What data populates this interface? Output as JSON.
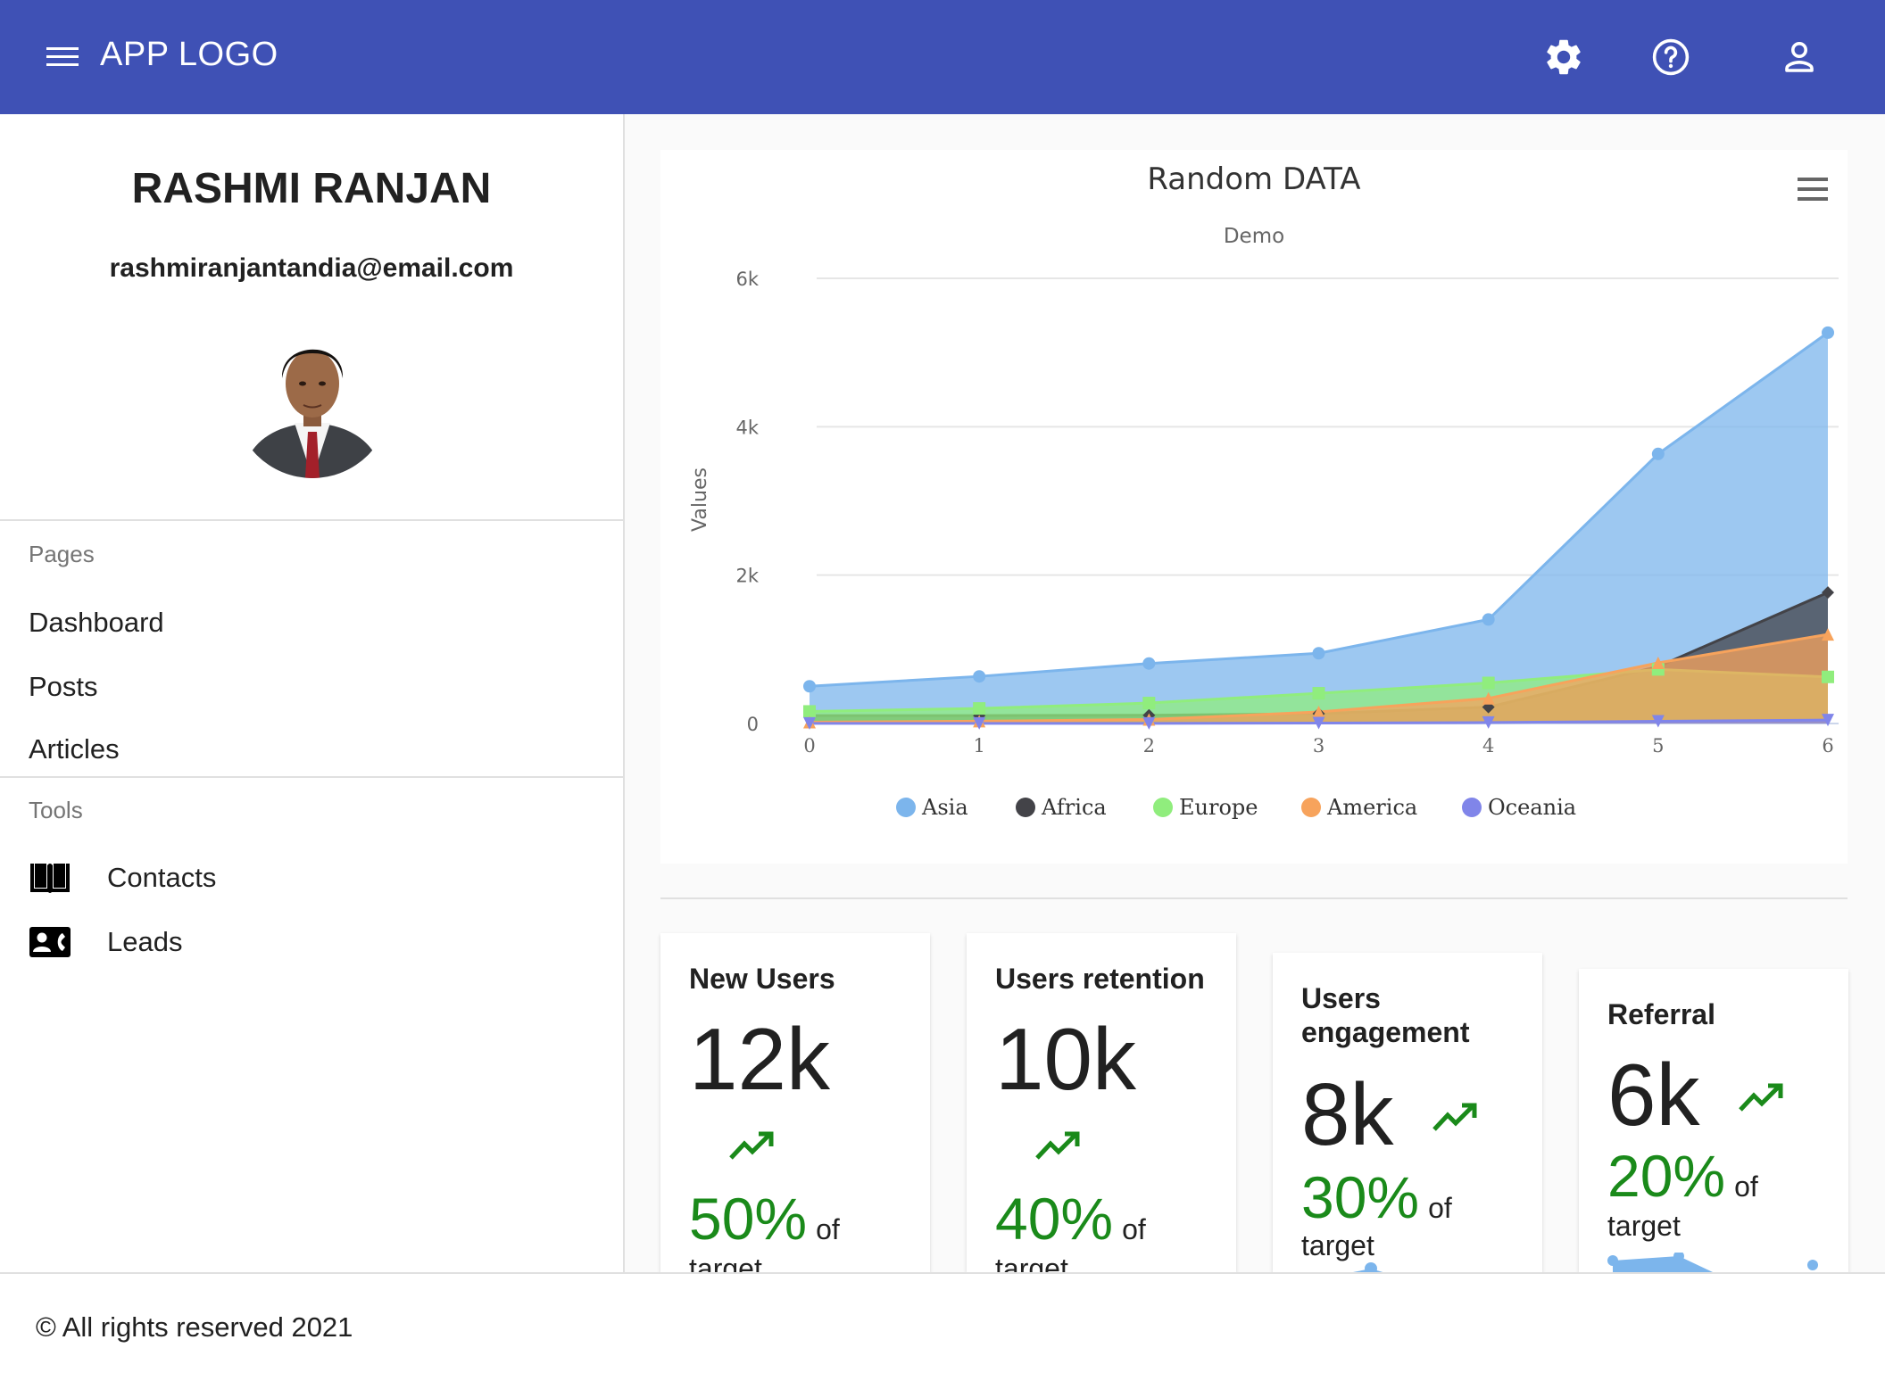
{
  "topbar": {
    "title": "APP LOGO",
    "icons": [
      "menu-icon",
      "settings-icon",
      "help-icon",
      "account-icon"
    ]
  },
  "profile": {
    "name": "RASHMI RANJAN",
    "email": "rashmiranjantandia@email.com"
  },
  "sidebar": {
    "pages_header": "Pages",
    "pages": [
      {
        "label": "Dashboard"
      },
      {
        "label": "Posts"
      },
      {
        "label": "Articles"
      }
    ],
    "tools_header": "Tools",
    "tools": [
      {
        "label": "Contacts",
        "icon": "book-icon"
      },
      {
        "label": "Leads",
        "icon": "contact-card-icon"
      }
    ]
  },
  "chart_data": {
    "type": "area",
    "title": "Random DATA",
    "subtitle": "Demo",
    "ylabel": "Values",
    "xlabel": "",
    "x": [
      0,
      1,
      2,
      3,
      4,
      5,
      6
    ],
    "x_tick_labels": [
      "0",
      "1",
      "2",
      "3",
      "4",
      "5",
      "6"
    ],
    "ylim": [
      0,
      6000
    ],
    "y_tick_labels": [
      "0",
      "2k",
      "4k",
      "6k"
    ],
    "y_tick_values": [
      0,
      2000,
      4000,
      6000
    ],
    "grid": true,
    "legend_position": "bottom",
    "stacked": false,
    "series": [
      {
        "name": "Asia",
        "color": "#7cb5ec",
        "marker": "circle",
        "values": [
          502,
          635,
          809,
          947,
          1402,
          3634,
          5268
        ]
      },
      {
        "name": "Africa",
        "color": "#434348",
        "marker": "diamond",
        "values": [
          106,
          107,
          111,
          133,
          221,
          767,
          1766
        ]
      },
      {
        "name": "Europe",
        "color": "#90ed7d",
        "marker": "square",
        "values": [
          163,
          203,
          276,
          408,
          547,
          729,
          628
        ]
      },
      {
        "name": "America",
        "color": "#f7a35c",
        "marker": "triangle",
        "values": [
          18,
          31,
          54,
          156,
          339,
          818,
          1201
        ]
      },
      {
        "name": "Oceania",
        "color": "#8085e9",
        "marker": "triangle-down",
        "values": [
          2,
          2,
          2,
          6,
          13,
          30,
          46
        ]
      }
    ]
  },
  "stats": [
    {
      "title": "New Users",
      "value": "12k",
      "percent": "50%",
      "of": "of",
      "target": "target",
      "color": "#1a8a1a"
    },
    {
      "title": "Users retention",
      "value": "10k",
      "percent": "40%",
      "of": "of",
      "target": "target",
      "color": "#1a8a1a"
    },
    {
      "title": "Users engagement",
      "value": "8k",
      "percent": "30%",
      "of": "of",
      "target": "target",
      "color": "#1a8a1a"
    },
    {
      "title": "Referral",
      "value": "6k",
      "percent": "20%",
      "of": "of",
      "target": "target",
      "color": "#1a8a1a"
    }
  ],
  "footer": {
    "text": "© All rights reserved 2021"
  }
}
